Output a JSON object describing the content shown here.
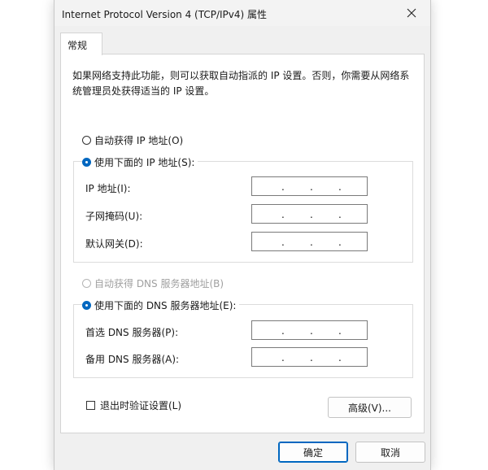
{
  "window": {
    "title": "Internet Protocol Version 4 (TCP/IPv4) 属性",
    "close_icon": "close-icon"
  },
  "tabs": [
    {
      "label": "常规",
      "active": true
    }
  ],
  "description": "如果网络支持此功能，则可以获取自动指派的 IP 设置。否则，你需要从网络系统管理员处获得适当的 IP 设置。",
  "ip": {
    "auto_label": "自动获得 IP 地址(O)",
    "auto_checked": false,
    "manual_label": "使用下面的 IP 地址(S):",
    "manual_checked": true,
    "fields": [
      {
        "label": "IP 地址(I):",
        "value": ""
      },
      {
        "label": "子网掩码(U):",
        "value": ""
      },
      {
        "label": "默认网关(D):",
        "value": ""
      }
    ]
  },
  "dns": {
    "auto_label": "自动获得 DNS 服务器地址(B)",
    "auto_checked": false,
    "auto_disabled": true,
    "manual_label": "使用下面的 DNS 服务器地址(E):",
    "manual_checked": true,
    "fields": [
      {
        "label": "首选 DNS 服务器(P):",
        "value": ""
      },
      {
        "label": "备用 DNS 服务器(A):",
        "value": ""
      }
    ]
  },
  "validate_on_exit": {
    "label": "退出时验证设置(L)",
    "checked": false
  },
  "buttons": {
    "advanced": "高级(V)...",
    "ok": "确定",
    "cancel": "取消"
  },
  "colors": {
    "accent": "#0067c0",
    "dialog_bg": "#f0f0f0",
    "panel_bg": "#ffffff"
  }
}
